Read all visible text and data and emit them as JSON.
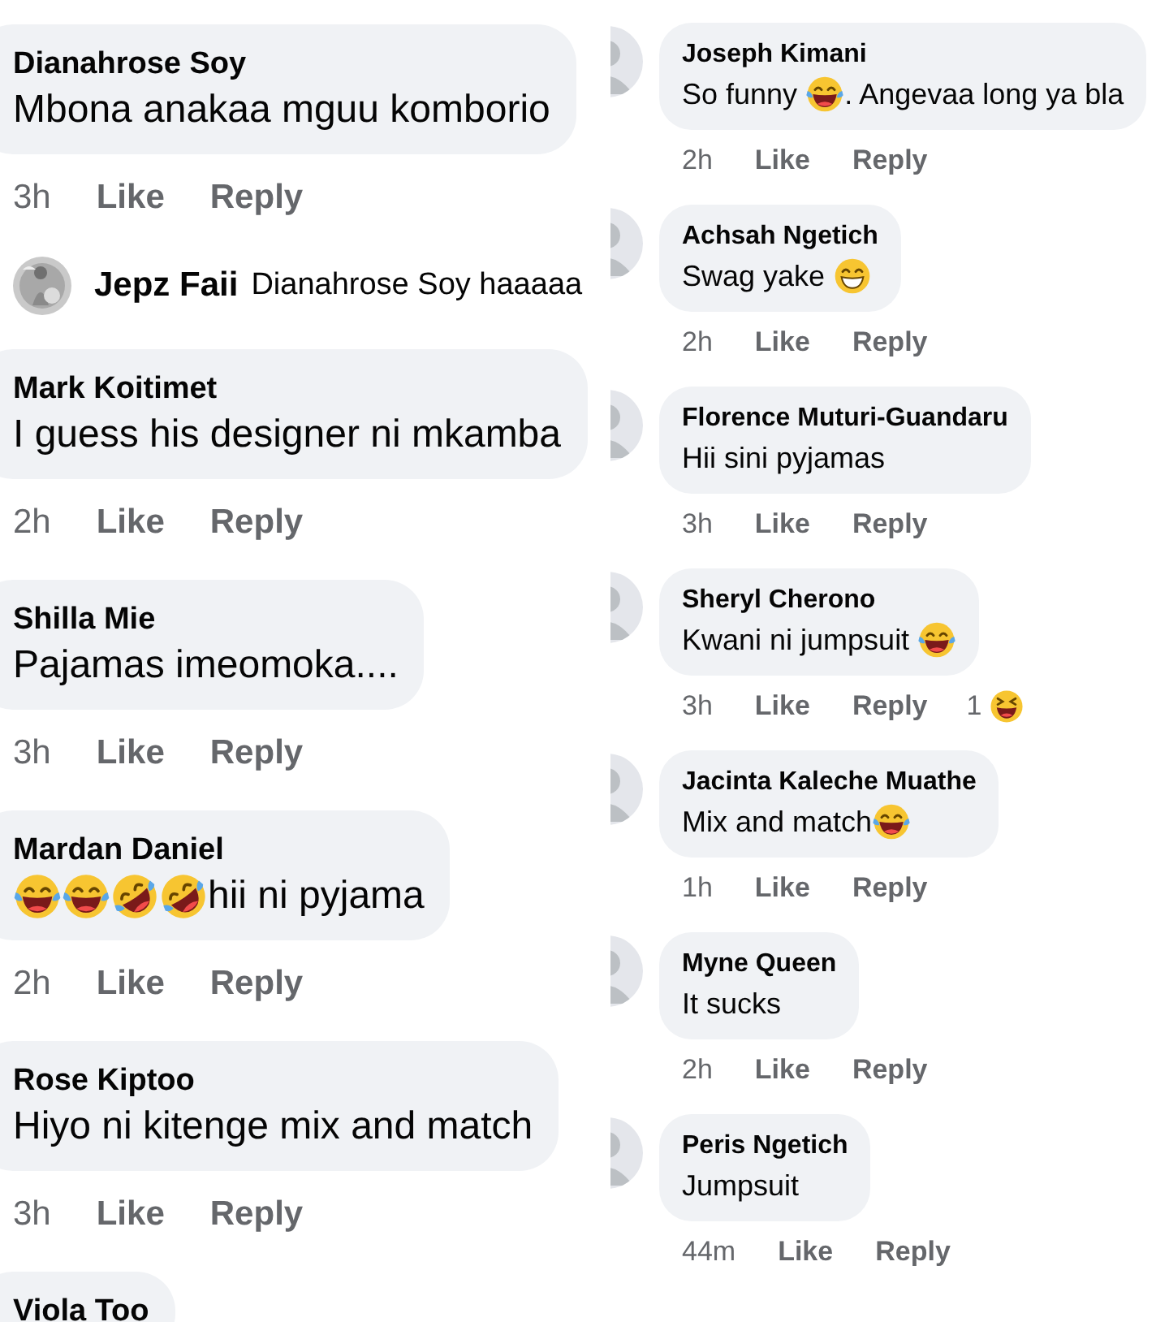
{
  "left_panel": {
    "comments": [
      {
        "author": "Dianahrose Soy",
        "body": [
          {
            "kind": "text",
            "text": "Mbona anakaa mguu komborio"
          }
        ],
        "time": "3h",
        "like": "Like",
        "reply": "Reply",
        "replies": [
          {
            "author": "Jepz Faii",
            "text": "Dianahrose Soy haaaaa"
          }
        ]
      },
      {
        "author": "Mark Koitimet",
        "body": [
          {
            "kind": "text",
            "text": "I guess his designer ni mkamba"
          }
        ],
        "time": "2h",
        "like": "Like",
        "reply": "Reply"
      },
      {
        "author": "Shilla Mie",
        "body": [
          {
            "kind": "text",
            "text": "Pajamas imeomoka...."
          }
        ],
        "time": "3h",
        "like": "Like",
        "reply": "Reply"
      },
      {
        "author": "Mardan Daniel",
        "body": [
          {
            "kind": "joy"
          },
          {
            "kind": "joy"
          },
          {
            "kind": "rofl"
          },
          {
            "kind": "rofl"
          },
          {
            "kind": "text",
            "text": "hii ni pyjama"
          }
        ],
        "time": "2h",
        "like": "Like",
        "reply": "Reply"
      },
      {
        "author": "Rose Kiptoo",
        "body": [
          {
            "kind": "text",
            "text": "Hiyo ni kitenge mix and match"
          }
        ],
        "time": "3h",
        "like": "Like",
        "reply": "Reply"
      },
      {
        "author": "Viola Too"
      }
    ]
  },
  "right_panel": {
    "comments": [
      {
        "author": "Joseph Kimani",
        "body": [
          {
            "kind": "text",
            "text": "So funny "
          },
          {
            "kind": "joy"
          },
          {
            "kind": "text",
            "text": ". Angevaa long ya bla"
          }
        ],
        "time": "2h",
        "like": "Like",
        "reply": "Reply"
      },
      {
        "author": "Achsah Ngetich",
        "body": [
          {
            "kind": "text",
            "text": "Swag yake "
          },
          {
            "kind": "grin"
          }
        ],
        "time": "2h",
        "like": "Like",
        "reply": "Reply"
      },
      {
        "author": "Florence Muturi-Guandaru",
        "body": [
          {
            "kind": "text",
            "text": "Hii sini pyjamas"
          }
        ],
        "time": "3h",
        "like": "Like",
        "reply": "Reply"
      },
      {
        "author": "Sheryl Cherono",
        "body": [
          {
            "kind": "text",
            "text": "Kwani ni jumpsuit "
          },
          {
            "kind": "joy"
          }
        ],
        "time": "3h",
        "like": "Like",
        "reply": "Reply",
        "reaction_count": "1"
      },
      {
        "author": "Jacinta Kaleche Muathe",
        "body": [
          {
            "kind": "text",
            "text": "Mix and match"
          },
          {
            "kind": "joy"
          }
        ],
        "time": "1h",
        "like": "Like",
        "reply": "Reply"
      },
      {
        "author": "Myne Queen",
        "body": [
          {
            "kind": "text",
            "text": "It sucks"
          }
        ],
        "time": "2h",
        "like": "Like",
        "reply": "Reply"
      },
      {
        "author": "Peris Ngetich",
        "body": [
          {
            "kind": "text",
            "text": "Jumpsuit"
          }
        ],
        "time": "44m",
        "like": "Like",
        "reply": "Reply"
      }
    ]
  }
}
